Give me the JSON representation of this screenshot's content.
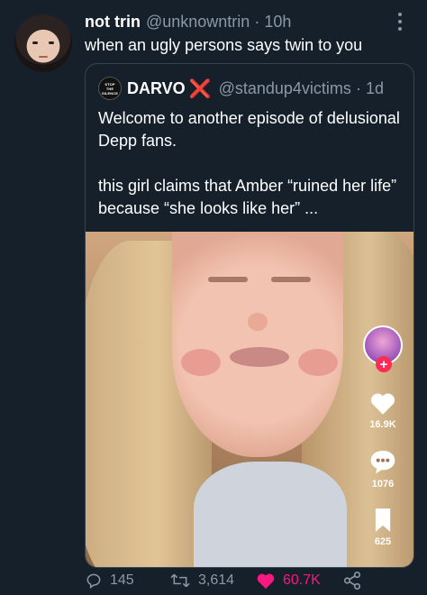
{
  "tweet": {
    "display_name": "not trin",
    "handle": "@unknowntrin",
    "separator": "·",
    "time": "10h",
    "text": "when an ugly persons says twin to you"
  },
  "quote": {
    "avatar_text": [
      "STOP",
      "THE",
      "SILENCE"
    ],
    "display_name": "DARVO",
    "name_emoji": "❌",
    "handle": "@standup4victims",
    "separator": "·",
    "time": "1d",
    "paragraph_1": "Welcome to another episode of delusional Depp fans.",
    "paragraph_2": "this girl claims that Amber “ruined her life” because “she looks like her” ..."
  },
  "video_overlay": {
    "follow_plus": "+",
    "likes": "16.9K",
    "comments": "1076",
    "saves": "625"
  },
  "actions": {
    "replies": "145",
    "retweets": "3,614",
    "likes": "60.7K"
  },
  "icons": {
    "more": "more-dots-icon",
    "reply": "reply-icon",
    "retweet": "retweet-icon",
    "like": "heart-icon",
    "share": "share-icon"
  },
  "colors": {
    "background": "#15202b",
    "secondary_text": "#8b98a5",
    "like_pink": "#f91880",
    "border": "#38444d"
  }
}
